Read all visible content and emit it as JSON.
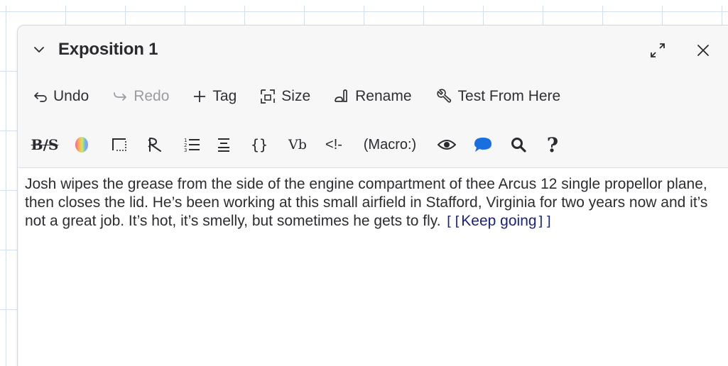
{
  "dialog": {
    "title": "Exposition 1",
    "collapse_icon": "chevron-down-icon",
    "maximize_icon": "maximize-icon",
    "close_icon": "close-icon"
  },
  "toolbar": {
    "undo": "Undo",
    "redo": "Redo",
    "tag": "Tag",
    "size": "Size",
    "rename": "Rename",
    "test_from_here": "Test From Here"
  },
  "format_toolbar": {
    "bold_strike": "B/S",
    "color_icon": "color-wheel-icon",
    "border_icon": "border-icon",
    "transition_icon": "transition-icon",
    "list_icon": "numbered-list-icon",
    "align_icon": "align-center-icon",
    "braces": "{}",
    "vb": "Vb",
    "comment": "<!-",
    "macro": "(Macro:)",
    "preview_icon": "eye-icon",
    "comment_icon": "speech-bubble-icon",
    "find_icon": "search-icon",
    "help": "?"
  },
  "editor": {
    "text": "Josh wipes the grease from the side of the engine compartment of thee Arcus 12 single propellor plane, then closes the lid. He’s been working at this small airfield in Stafford, Virginia for two years now and it’s not a great job. It’s hot, it’s smelly, but sometimes he gets to fly.",
    "link_open": "[[",
    "link_text": "Keep going",
    "link_close": "]]"
  },
  "colors": {
    "accent_blue": "#1a6fe0",
    "link_navy": "#1a237e",
    "text": "#2d2d31",
    "disabled": "#9a9ca2"
  }
}
